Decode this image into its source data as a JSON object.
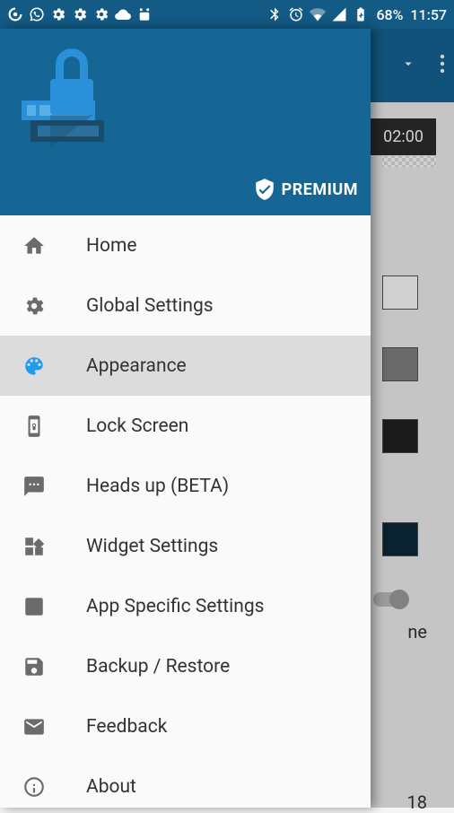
{
  "status_bar": {
    "battery_text": "68%",
    "clock": "11:57"
  },
  "drawer": {
    "premium_label": "PREMIUM",
    "items": [
      {
        "label": "Home"
      },
      {
        "label": "Global Settings"
      },
      {
        "label": "Appearance"
      },
      {
        "label": "Lock Screen"
      },
      {
        "label": "Heads up (BETA)"
      },
      {
        "label": "Widget Settings"
      },
      {
        "label": "App Specific Settings"
      },
      {
        "label": "Backup / Restore"
      },
      {
        "label": "Feedback"
      },
      {
        "label": "About"
      }
    ]
  },
  "background": {
    "time_chip": "02:00",
    "partial_text_1": "ne",
    "partial_text_2": "18"
  }
}
